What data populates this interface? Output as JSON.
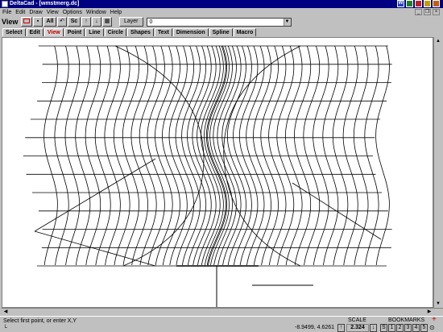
{
  "window": {
    "title": "DeltaCad - [wmstmerg.dc]"
  },
  "sysicons": [
    "W",
    "",
    "",
    "",
    ""
  ],
  "menu": [
    "File",
    "Edit",
    "Draw",
    "View",
    "Options",
    "Window",
    "Help"
  ],
  "toolbar": {
    "mode_label": "View",
    "buttons": [
      "",
      "▪",
      "All",
      "",
      "Sc",
      "↑",
      "↓",
      ""
    ],
    "layer_label": "Layer",
    "layer_value": "0"
  },
  "tabs": [
    "Select",
    "Edit",
    "View",
    "Point",
    "Line",
    "Circle",
    "Shapes",
    "Text",
    "Dimension",
    "Spline",
    "Macro"
  ],
  "active_tab": "View",
  "status": {
    "prompt": "Select first point, or enter X,Y",
    "coords": "-8.9499, 4.6261",
    "scale_label": "SCALE",
    "scale_value": "2.324",
    "bookmarks_label": "BOOKMARKS",
    "bookmarks": [
      "S",
      "1",
      "2",
      "3",
      "4",
      "5"
    ]
  }
}
